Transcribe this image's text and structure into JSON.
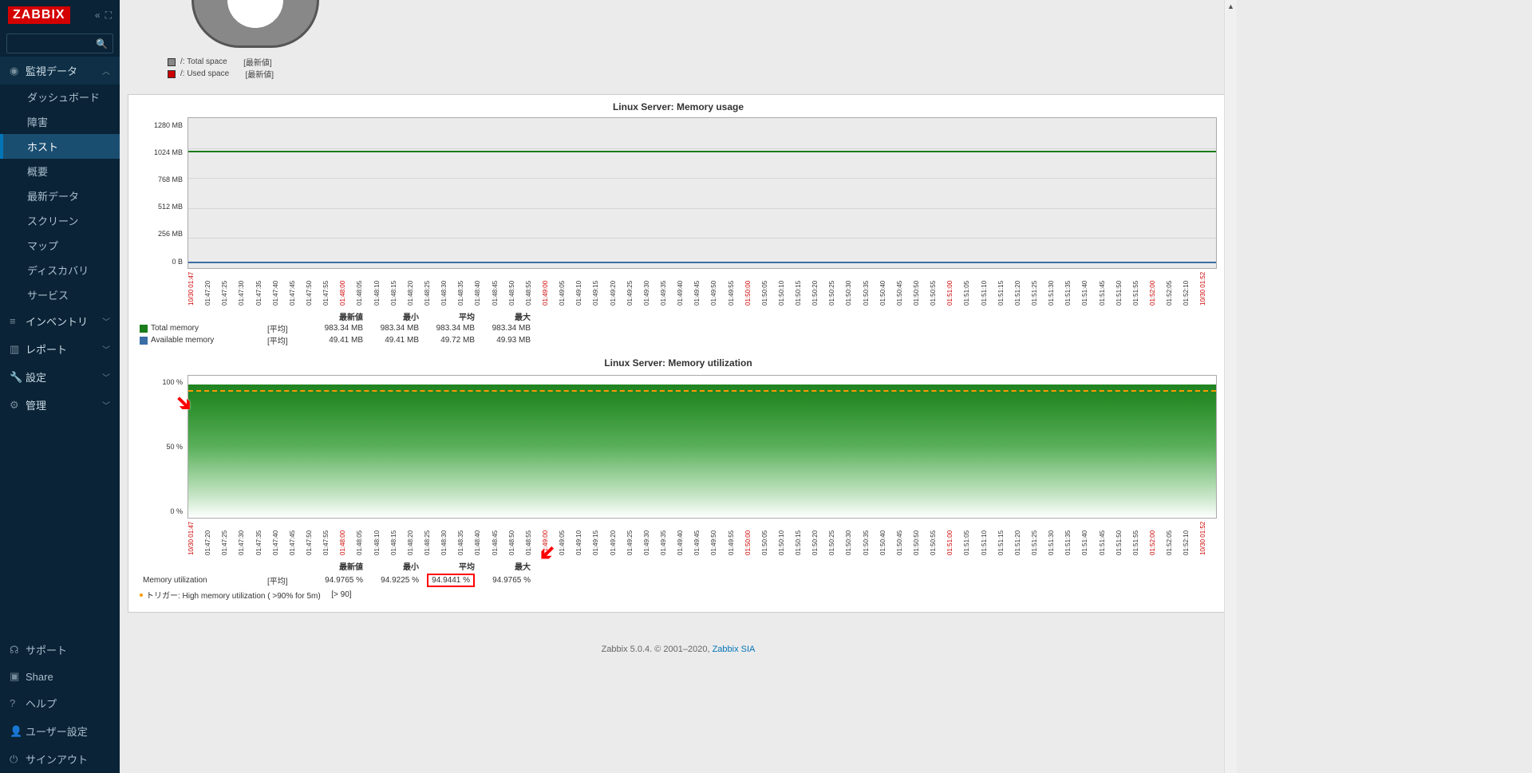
{
  "logo": "ZABBIX",
  "nav": {
    "monitoring": "監視データ",
    "sub": [
      "ダッシュボード",
      "障害",
      "ホスト",
      "概要",
      "最新データ",
      "スクリーン",
      "マップ",
      "ディスカバリ",
      "サービス"
    ],
    "inventory": "インベントリ",
    "reports": "レポート",
    "settings": "設定",
    "admin": "管理"
  },
  "bottom": {
    "support": "サポート",
    "share": "Share",
    "help": "ヘルプ",
    "user": "ユーザー設定",
    "signout": "サインアウト"
  },
  "pie_legend": {
    "total": "/: Total space",
    "used": "/: Used space",
    "latest": "[最新値]"
  },
  "chart1": {
    "title": "Linux Server: Memory usage",
    "ylabels": [
      "1280 MB",
      "1024 MB",
      "768 MB",
      "512 MB",
      "256 MB",
      "0 B"
    ]
  },
  "chart1_legend": {
    "h_latest": "最新値",
    "h_min": "最小",
    "h_avg": "平均",
    "h_max": "最大",
    "total": "Total memory",
    "avail": "Available memory",
    "avg": "[平均]",
    "tvals": [
      "983.34 MB",
      "983.34 MB",
      "983.34 MB",
      "983.34 MB"
    ],
    "avals": [
      "49.41 MB",
      "49.41 MB",
      "49.72 MB",
      "49.93 MB"
    ]
  },
  "chart2": {
    "title": "Linux Server: Memory utilization",
    "ylabels": [
      "100 %",
      "50 %",
      "0 %"
    ]
  },
  "chart2_legend": {
    "h_latest": "最新値",
    "h_min": "最小",
    "h_avg": "平均",
    "h_max": "最大",
    "name": "Memory utilization",
    "avg": "[平均]",
    "vals": [
      "94.9765 %",
      "94.9225 %",
      "94.9441 %",
      "94.9765 %"
    ],
    "trigger": "トリガー: High memory utilization ( >90% for 5m)",
    "trigger_val": "[> 90]"
  },
  "xaxis": {
    "start": "10/30 01:47",
    "end": "10/30 01:52",
    "ticks": [
      "01:47:20",
      "01:47:25",
      "01:47:30",
      "01:47:35",
      "01:47:40",
      "01:47:45",
      "01:47:50",
      "01:47:55",
      "01:48:00",
      "01:48:05",
      "01:48:10",
      "01:48:15",
      "01:48:20",
      "01:48:25",
      "01:48:30",
      "01:48:35",
      "01:48:40",
      "01:48:45",
      "01:48:50",
      "01:48:55",
      "01:49:00",
      "01:49:05",
      "01:49:10",
      "01:49:15",
      "01:49:20",
      "01:49:25",
      "01:49:30",
      "01:49:35",
      "01:49:40",
      "01:49:45",
      "01:49:50",
      "01:49:55",
      "01:50:00",
      "01:50:05",
      "01:50:10",
      "01:50:15",
      "01:50:20",
      "01:50:25",
      "01:50:30",
      "01:50:35",
      "01:50:40",
      "01:50:45",
      "01:50:50",
      "01:50:55",
      "01:51:00",
      "01:51:05",
      "01:51:10",
      "01:51:15",
      "01:51:20",
      "01:51:25",
      "01:51:30",
      "01:51:35",
      "01:51:40",
      "01:51:45",
      "01:51:50",
      "01:51:55",
      "01:52:00",
      "01:52:05",
      "01:52:10"
    ],
    "red_idx": [
      8,
      20,
      32,
      44,
      56
    ]
  },
  "footer": {
    "text": "Zabbix 5.0.4. © 2001–2020, ",
    "link": "Zabbix SIA"
  },
  "chart_data": [
    {
      "type": "line",
      "title": "Linux Server: Memory usage",
      "ylabel": "MB",
      "ylim": [
        0,
        1280
      ],
      "x_range": [
        "01:47:20",
        "01:52:10"
      ],
      "series": [
        {
          "name": "Total memory",
          "value_constant": 983.34,
          "color": "#1a7d1a"
        },
        {
          "name": "Available memory",
          "value_constant": 49.7,
          "color": "#3a6ea5"
        }
      ]
    },
    {
      "type": "area",
      "title": "Linux Server: Memory utilization",
      "ylabel": "%",
      "ylim": [
        0,
        100
      ],
      "x_range": [
        "01:47:20",
        "01:52:10"
      ],
      "series": [
        {
          "name": "Memory utilization",
          "value_constant": 94.95,
          "color": "#1a7d1a"
        }
      ],
      "trigger": {
        "name": "High memory utilization ( >90% for 5m)",
        "threshold": 90
      }
    }
  ]
}
